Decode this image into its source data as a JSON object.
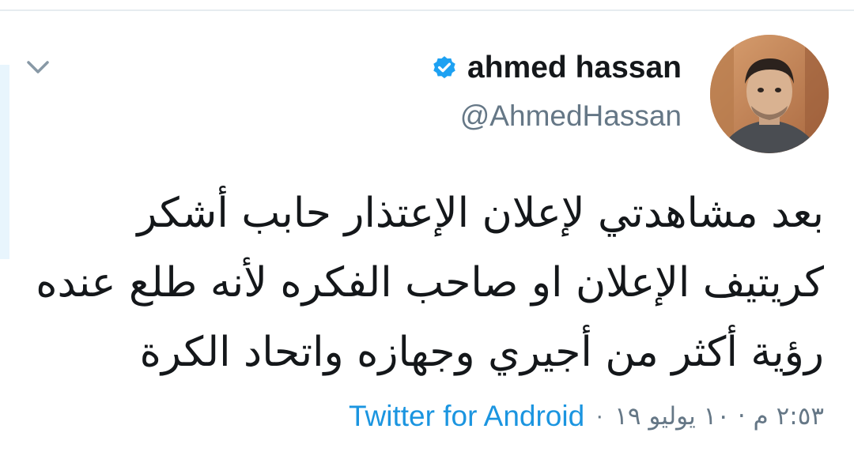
{
  "tweet": {
    "user": {
      "display_name": "ahmed hassan",
      "handle": "@AhmedHassan",
      "verified": true
    },
    "text_lines": [
      "بعد مشاهدتي لإعلان الإعتذار حابب أشكر",
      "كريتيف الإعلان او صاحب الفكره لأنه طلع عنده",
      "رؤية أكثر من أجيري وجهازه واتحاد الكرة"
    ],
    "timestamp": "٢:٥٣ م · ١٠ يوليو ١٩",
    "separator": "·",
    "source": "Twitter for Android"
  },
  "icons": {
    "menu": "chevron-down-icon",
    "verified": "verified-badge-icon",
    "avatar": "profile-photo"
  },
  "colors": {
    "text": "#14171a",
    "secondary": "#657786",
    "link": "#1b95e0",
    "verified": "#1da1f2"
  }
}
